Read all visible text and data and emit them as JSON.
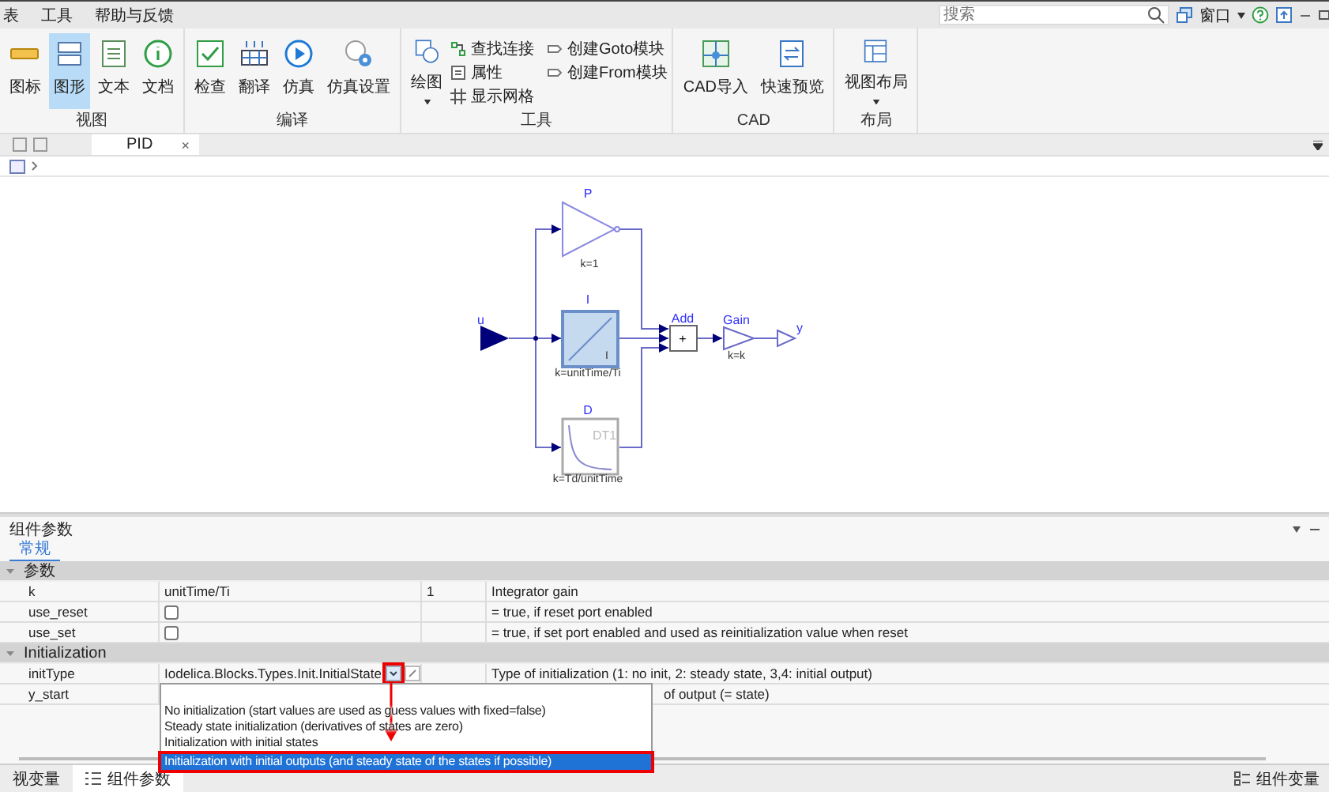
{
  "menu": [
    "表",
    "工具",
    "帮助与反馈"
  ],
  "search": {
    "placeholder": "搜索"
  },
  "window_menu": {
    "label": "窗口"
  },
  "ribbon": [
    {
      "label": "视图",
      "buttons": [
        {
          "label": "图标",
          "selected": false
        },
        {
          "label": "图形",
          "selected": true
        },
        {
          "label": "文本",
          "selected": false
        },
        {
          "label": "文档",
          "selected": false
        }
      ]
    },
    {
      "label": "编译",
      "buttons": [
        {
          "label": "检查"
        },
        {
          "label": "翻译"
        },
        {
          "label": "仿真"
        },
        {
          "label": "仿真设置"
        }
      ]
    },
    {
      "label": "工具",
      "buttons": [
        {
          "label": "绘图",
          "has_menu": true
        }
      ],
      "small_buttons": [
        {
          "label": "查找连接"
        },
        {
          "label": "属性"
        },
        {
          "label": "显示网格"
        },
        {
          "label": "创建Goto模块"
        },
        {
          "label": "创建From模块"
        }
      ]
    },
    {
      "label": "CAD",
      "buttons": [
        {
          "label": "CAD导入"
        },
        {
          "label": "快速预览"
        }
      ]
    },
    {
      "label": "布局",
      "buttons": [
        {
          "label": "视图布局",
          "has_menu": true
        }
      ]
    }
  ],
  "doc_tabs": [
    {
      "label": "PID",
      "close": "×"
    }
  ],
  "diagram": {
    "input": "u",
    "output": "y",
    "add_symbol": "+",
    "blocks": [
      {
        "name": "P",
        "param": "k=1"
      },
      {
        "name": "I",
        "param": "k=unitTime/Ti",
        "inner": "I"
      },
      {
        "name": "D",
        "param": "k=Td/unitTime",
        "inner": "DT1"
      },
      {
        "name": "Add"
      },
      {
        "name": "Gain",
        "param": "k=k"
      }
    ]
  },
  "panel": {
    "title": "组件参数",
    "tabs": [
      {
        "label": "常规",
        "selected": true
      }
    ],
    "groups": [
      {
        "label": "参数",
        "expanded": true,
        "rows": [
          {
            "name": "k",
            "kind": "text",
            "value": "unitTime/Ti",
            "unit": "1",
            "description": "Integrator gain"
          },
          {
            "name": "use_reset",
            "kind": "checkbox",
            "checked": false,
            "description": "= true, if reset port enabled"
          },
          {
            "name": "use_set",
            "kind": "checkbox",
            "checked": false,
            "description": "= true, if set port enabled and used as reinitialization value when reset"
          }
        ]
      },
      {
        "label": "Initialization",
        "expanded": true,
        "rows": [
          {
            "name": "initType",
            "kind": "dropdown",
            "value": "Iodelica.Blocks.Types.Init.InitialState",
            "description": "Type of initialization (1: no init, 2: steady state, 3,4: initial output)",
            "open": true,
            "options": [
              {
                "label": "No initialization (start values are used as guess values with fixed=false)",
                "selected": false
              },
              {
                "label": "Steady state initialization (derivatives of states are zero)",
                "selected": false
              },
              {
                "label": "Initialization with initial states",
                "selected": false
              },
              {
                "label": "Initialization with initial outputs (and steady state of the states if possible)",
                "selected": true
              }
            ]
          },
          {
            "name": "y_start",
            "kind": "text",
            "description": "of output (= state)"
          }
        ]
      }
    ]
  },
  "bottom_tabs": [
    {
      "label": "视变量",
      "selected": false
    },
    {
      "label": "组件参数",
      "selected": true
    }
  ],
  "bottom_right": {
    "label": "组件变量"
  }
}
